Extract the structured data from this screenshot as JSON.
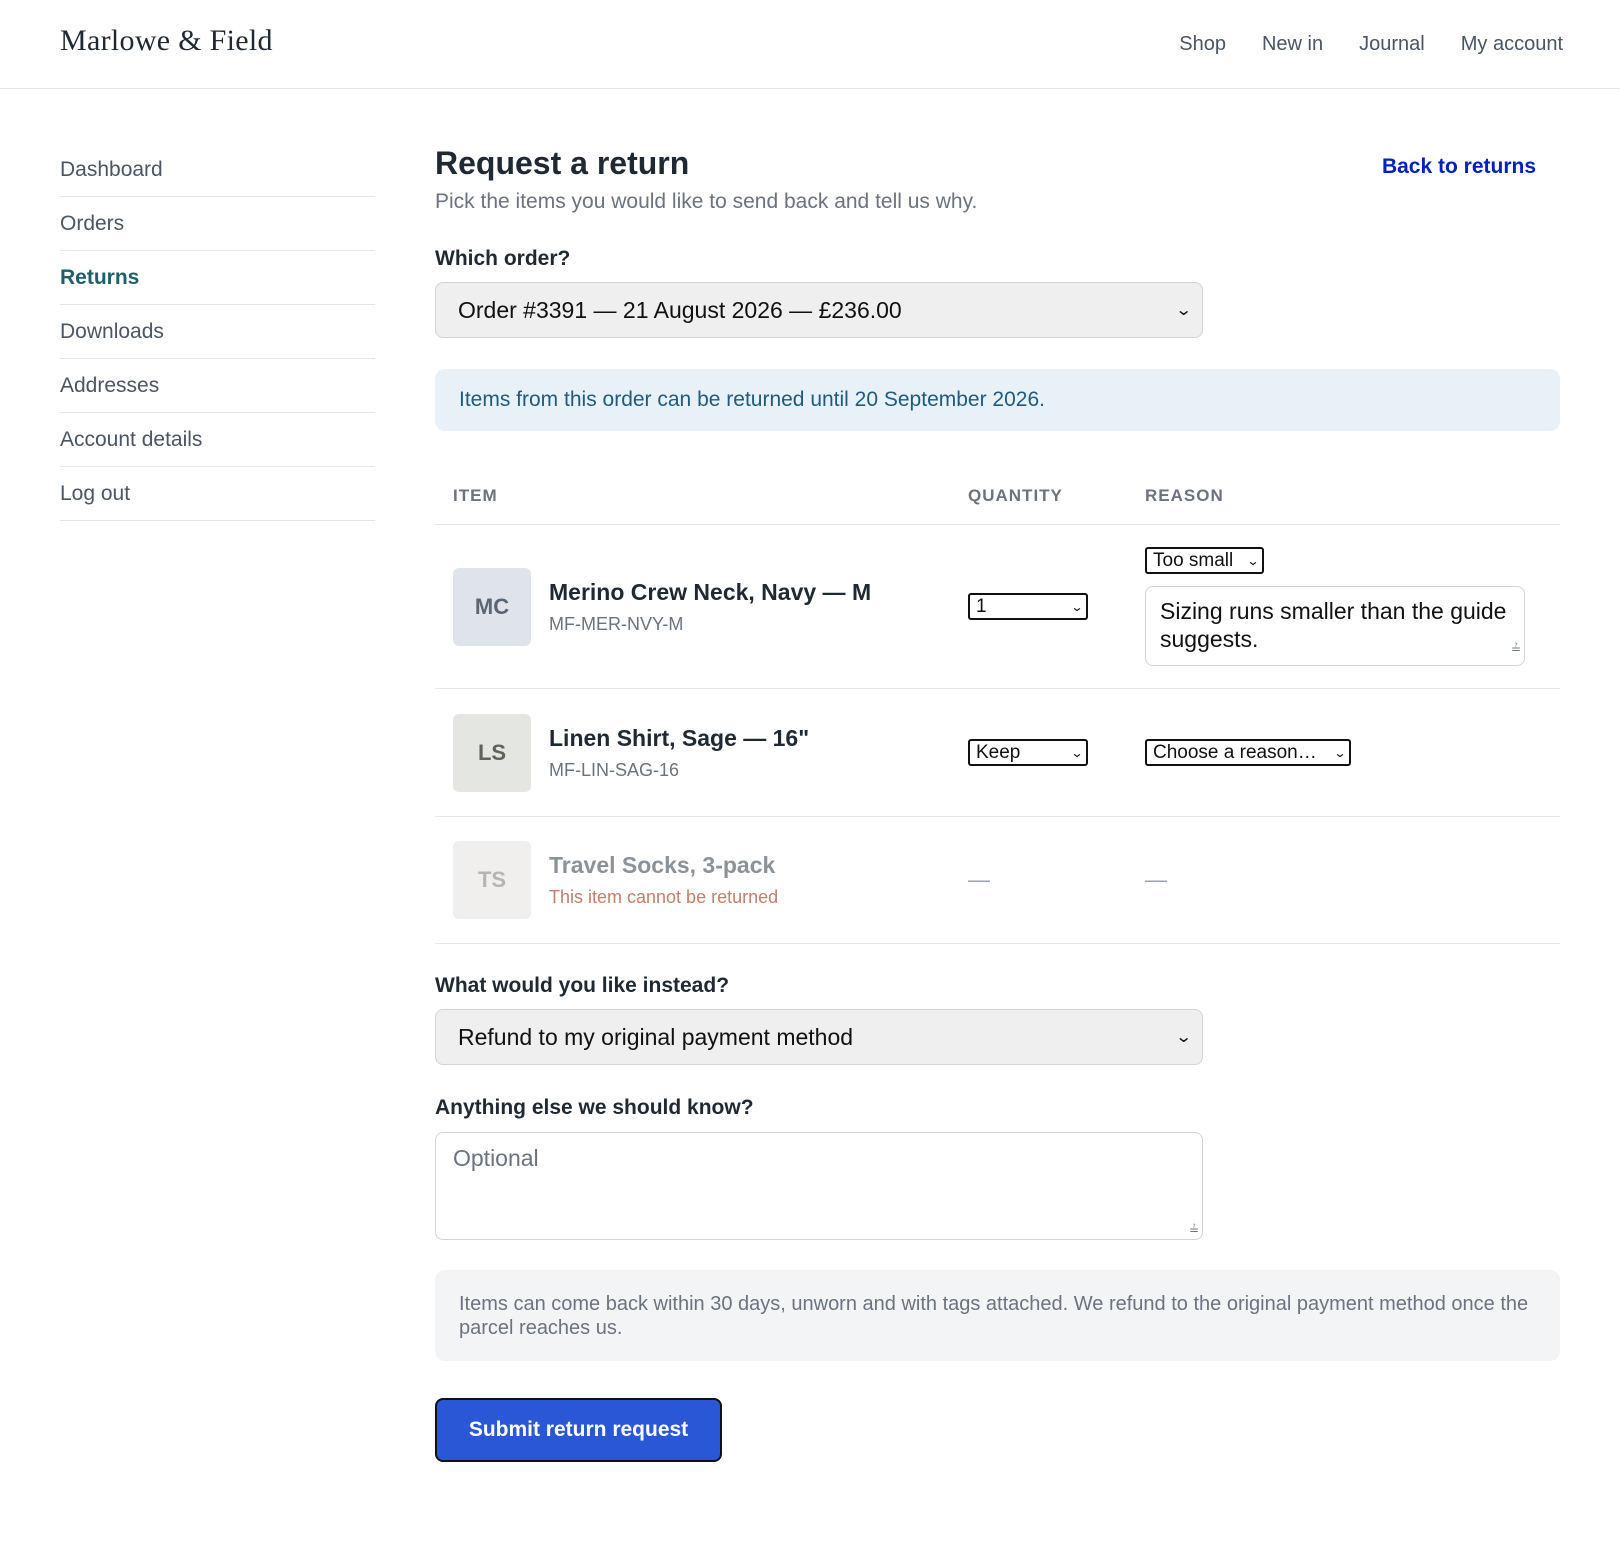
{
  "brand": "Marlowe & Field",
  "topnav": [
    "Shop",
    "New in",
    "Journal",
    "My account"
  ],
  "sidebar": {
    "items": [
      {
        "label": "Dashboard"
      },
      {
        "label": "Orders"
      },
      {
        "label": "Returns",
        "active": true
      },
      {
        "label": "Downloads"
      },
      {
        "label": "Addresses"
      },
      {
        "label": "Account details"
      },
      {
        "label": "Log out"
      }
    ]
  },
  "page": {
    "title": "Request a return",
    "subtitle": "Pick the items you would like to send back and tell us why.",
    "back_link": "Back to returns"
  },
  "order": {
    "label": "Which order?",
    "selected": "Order #3391 — 21 August 2026 — £236.00"
  },
  "info": "Items from this order can be returned until 20 September 2026.",
  "table": {
    "headers": {
      "item": "ITEM",
      "quantity": "QUANTITY",
      "reason": "REASON"
    },
    "rows": [
      {
        "initials": "MC",
        "name": "Merino Crew Neck, Navy — M",
        "sku": "MF-MER-NVY-M",
        "quantity": "1",
        "reason": "Too small",
        "reason_note": "Sizing runs smaller than the guide suggests."
      },
      {
        "initials": "LS",
        "name": "Linen Shirt, Sage — 16\"",
        "sku": "MF-LIN-SAG-16",
        "quantity": "Keep",
        "reason": "Choose a reason…"
      },
      {
        "initials": "TS",
        "name": "Travel Socks, 3-pack",
        "note": "This item cannot be returned",
        "quantity": "—",
        "reason": "—"
      }
    ]
  },
  "instead": {
    "label": "What would you like instead?",
    "selected": "Refund to my original payment method"
  },
  "notes": {
    "label": "Anything else we should know?",
    "placeholder": "Optional"
  },
  "policy": "Items can come back within 30 days, unworn and with tags attached. We refund to the original payment method once the parcel reaches us.",
  "submit_label": "Submit return request",
  "colors": {
    "accent": "#2a57d6",
    "link": "#0021c2",
    "active_nav": "#1f5f6b",
    "info_bg": "#e8f1f8",
    "disabled_note": "#c0806a"
  }
}
